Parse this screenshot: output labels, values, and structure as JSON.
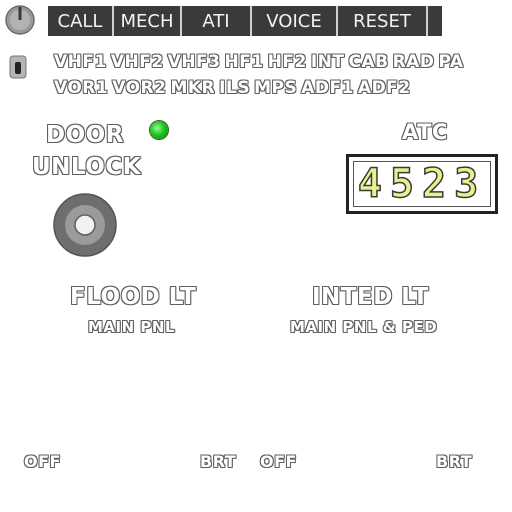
{
  "topbar": {
    "buttons": [
      {
        "label": "CALL"
      },
      {
        "label": "MECH"
      },
      {
        "label": "ATI"
      },
      {
        "label": "VOICE"
      },
      {
        "label": "RESET"
      }
    ]
  },
  "comm": {
    "row1": [
      "VHF1",
      "VHF2",
      "VHF3",
      "HF1",
      "HF2",
      "INT",
      "CAB",
      "RAD",
      "PA"
    ],
    "row2": [
      "VOR1",
      "VOR2",
      "MKR",
      "ILS",
      "MPS",
      "ADF1",
      "ADF2"
    ]
  },
  "door": {
    "line1": "DOOR",
    "line2": "UNLOCK",
    "light_color": "#1ec71e"
  },
  "atc": {
    "label": "ATC",
    "code": "4523"
  },
  "flood": {
    "title": "FLOOD LT",
    "subtitle": "MAIN PNL",
    "off_label": "OFF",
    "brt_label": "BRT"
  },
  "inted": {
    "title": "INTED LT",
    "subtitle": "MAIN PNL & PED",
    "off_label": "OFF",
    "brt_label": "BRT"
  }
}
